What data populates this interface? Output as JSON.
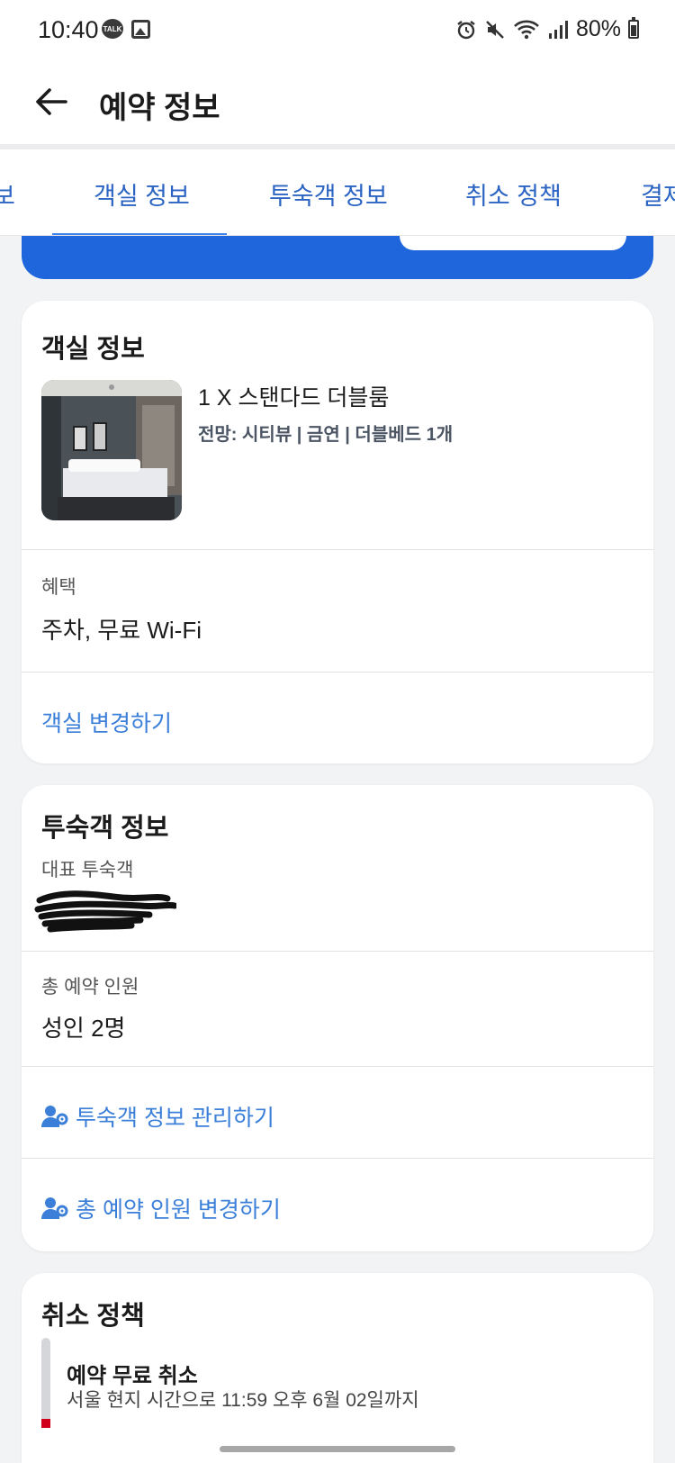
{
  "status_bar": {
    "time": "10:40",
    "talk_badge": "TALK",
    "battery": "80%"
  },
  "header": {
    "title": "예약 정보"
  },
  "tabs": [
    {
      "label": "보"
    },
    {
      "label": "객실 정보",
      "active": true
    },
    {
      "label": "투숙객 정보"
    },
    {
      "label": "취소 정책"
    },
    {
      "label": "결제"
    }
  ],
  "room_card": {
    "title": "객실 정보",
    "room_name": "1 X 스탠다드 더블룸",
    "room_details": "전망: 시티뷰 | 금연 | 더블베드 1개",
    "benefit_label": "혜택",
    "benefit_value": "주차, 무료 Wi-Fi",
    "change_room_link": "객실 변경하기"
  },
  "guest_card": {
    "title": "투숙객 정보",
    "main_guest_label": "대표 투숙객",
    "total_label": "총 예약 인원",
    "total_value": "성인 2명",
    "manage_link": "투숙객 정보 관리하기",
    "change_count_link": "총 예약 인원 변경하기"
  },
  "cancel_card": {
    "title": "취소 정책",
    "policy_title": "예약 무료 취소",
    "policy_sub": "서울 현지 시간으로 11:59 오후 6월 02일까지"
  },
  "colors": {
    "accent": "#2b64c3",
    "link": "#3b7fd9",
    "banner": "#1f66dc",
    "policy_marker": "#d0021b"
  }
}
